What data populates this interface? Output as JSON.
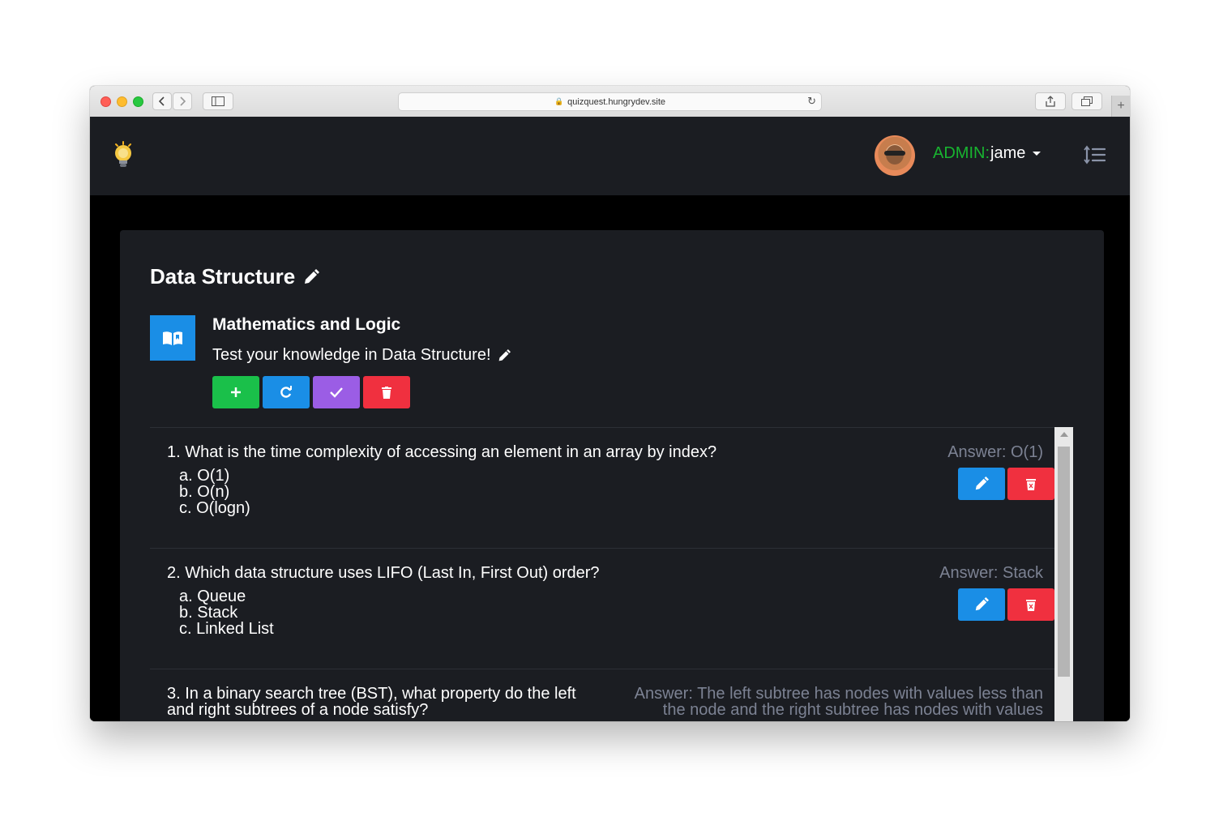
{
  "browser": {
    "url": "quizquest.hungrydev.site"
  },
  "header": {
    "admin_label": "ADMIN:",
    "username": "jame"
  },
  "quiz": {
    "title": "Data Structure",
    "category": "Mathematics and Logic",
    "description": "Test your knowledge in Data Structure!",
    "actions": [
      "+",
      "C",
      "✓",
      "delete"
    ]
  },
  "questions": [
    {
      "text": "1. What is the time complexity of accessing an element in an array by index?",
      "options": [
        "a. O(1)",
        "b. O(n)",
        "c. O(logn)"
      ],
      "answer": "Answer: O(1)"
    },
    {
      "text": "2. Which data structure uses LIFO (Last In, First Out) order?",
      "options": [
        "a. Queue",
        "b. Stack",
        "c. Linked List"
      ],
      "answer": "Answer: Stack"
    },
    {
      "text": "3. In a binary search tree (BST), what property do the left and right subtrees of a node satisfy?",
      "options": [],
      "answer": "Answer: The left subtree has nodes with values less than the node and the right subtree has nodes with values"
    }
  ],
  "colors": {
    "green": "#1ac04a",
    "blue": "#1a8ee6",
    "purple": "#9b5de5",
    "red": "#f0303f",
    "admin_green": "#18b430",
    "answer_gray": "#7c8293"
  }
}
